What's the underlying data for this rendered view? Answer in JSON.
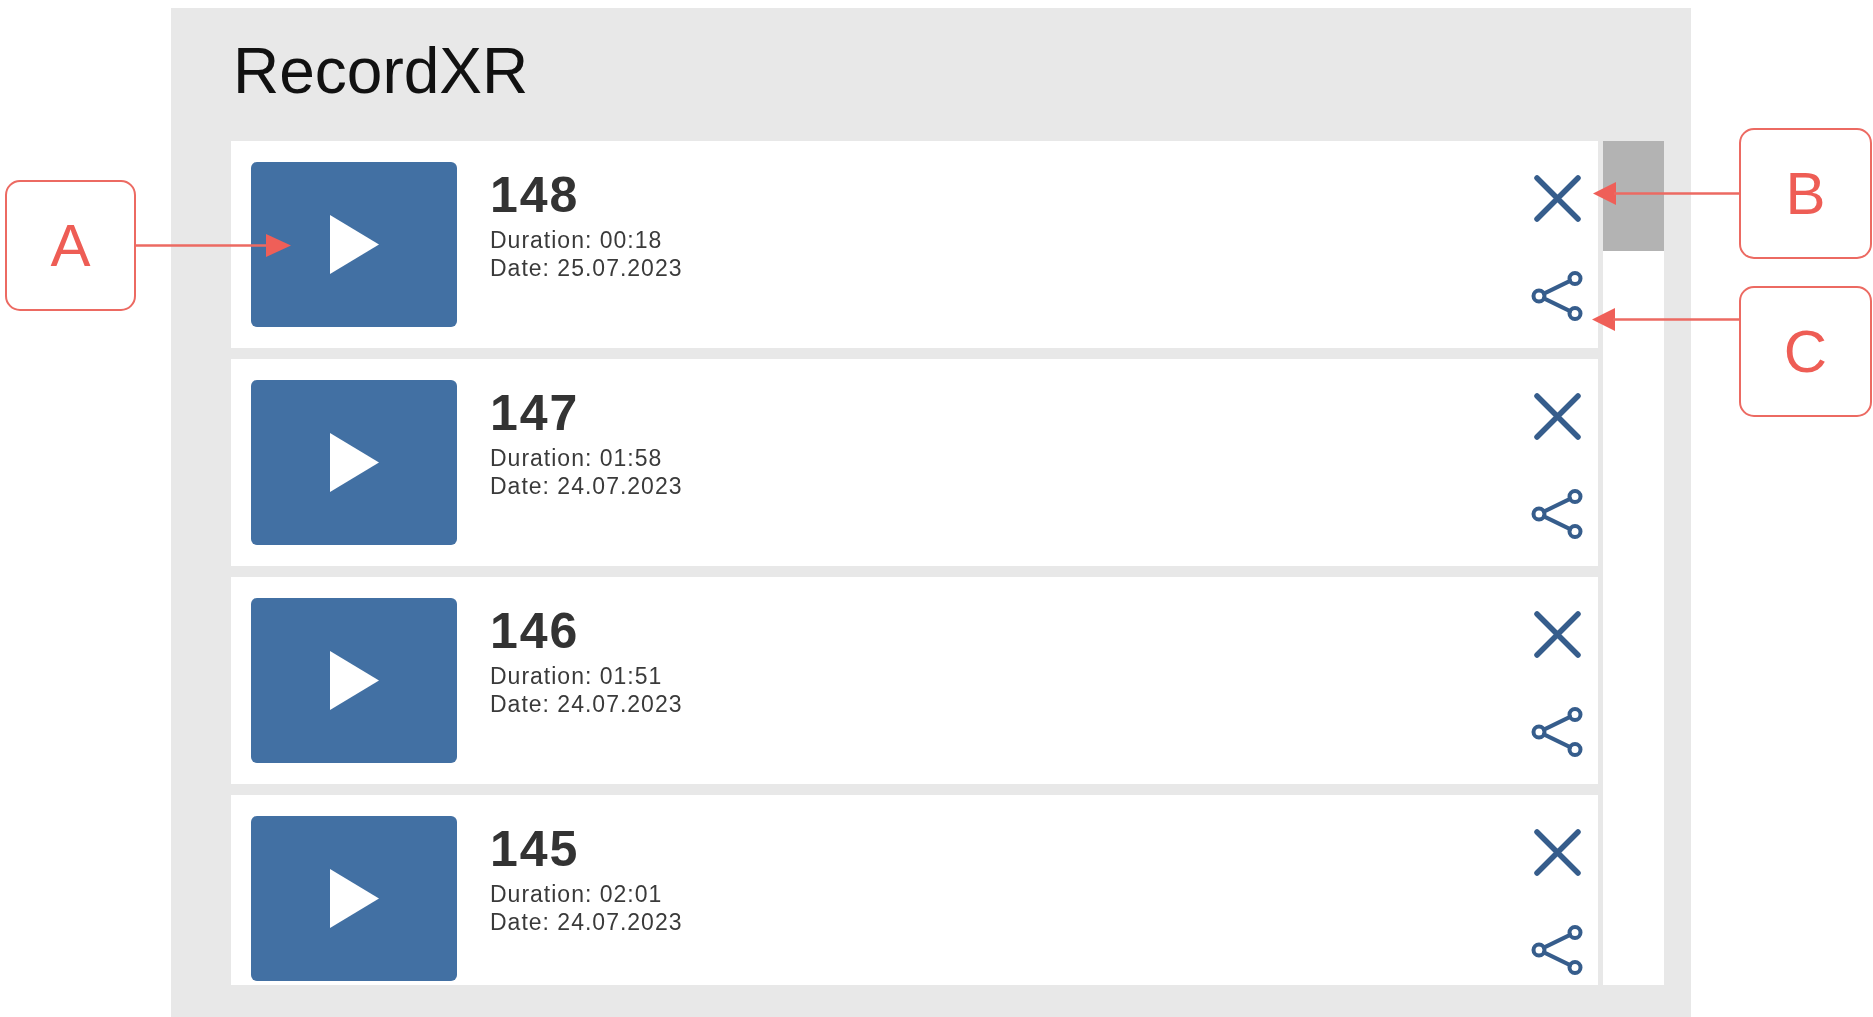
{
  "app": {
    "title": "RecordXR"
  },
  "recordings": [
    {
      "number": "148",
      "duration": "Duration: 00:18",
      "date": "Date: 25.07.2023"
    },
    {
      "number": "147",
      "duration": "Duration: 01:58",
      "date": "Date: 24.07.2023"
    },
    {
      "number": "146",
      "duration": "Duration: 01:51",
      "date": "Date: 24.07.2023"
    },
    {
      "number": "145",
      "duration": "Duration: 02:01",
      "date": "Date: 24.07.2023"
    }
  ],
  "callouts": [
    {
      "label": "A"
    },
    {
      "label": "B"
    },
    {
      "label": "C"
    }
  ]
}
